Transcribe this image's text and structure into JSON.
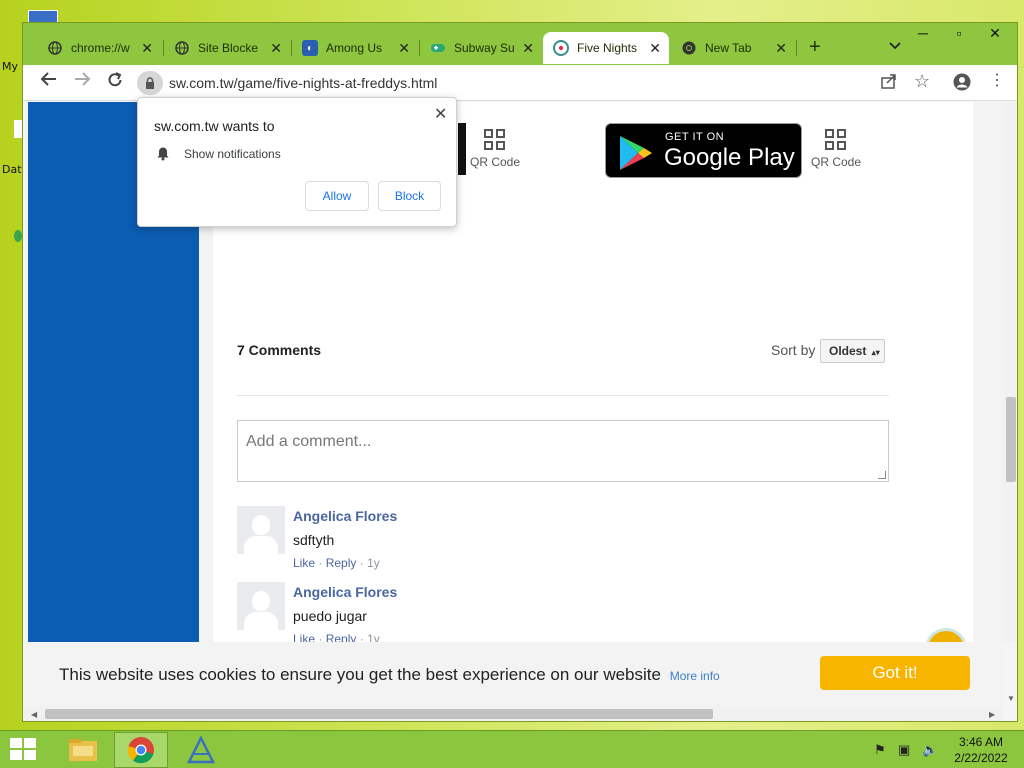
{
  "desktop": {
    "icons": [
      {
        "label": "My"
      },
      {
        "label": "Dat"
      }
    ]
  },
  "browser": {
    "tabs": [
      {
        "label": "chrome://w",
        "icon": "globe-icon",
        "active": false
      },
      {
        "label": "Site Blocke",
        "icon": "globe-icon",
        "active": false
      },
      {
        "label": "Among Us",
        "icon": "app-icon",
        "active": false
      },
      {
        "label": "Subway Su",
        "icon": "gamepad-icon",
        "active": false
      },
      {
        "label": "Five Nights",
        "icon": "site-icon",
        "active": true
      },
      {
        "label": "New Tab",
        "icon": "chrome-icon",
        "active": false
      }
    ],
    "new_tab_symbol": "+",
    "url": "sw.com.tw/game/five-nights-at-freddys.html"
  },
  "page": {
    "store": {
      "small_text": "GET IT ON",
      "big_text": "Google Play"
    },
    "qr_label_1": "QR Code",
    "qr_label_2": "QR Code",
    "comments": {
      "count_label": "7 Comments",
      "sort_label": "Sort by",
      "sort_value": "Oldest",
      "input_placeholder": "Add a comment...",
      "items": [
        {
          "author": "Angelica Flores",
          "text": "sdftyth",
          "like": "Like",
          "reply": "Reply",
          "age": "1y"
        },
        {
          "author": "Angelica Flores",
          "text": "puedo jugar",
          "like": "Like",
          "reply": "Reply",
          "age": "1y"
        }
      ]
    },
    "cookie": {
      "text": "This website uses cookies to ensure you get the best experience on our website",
      "more": "More info",
      "button": "Got it!"
    }
  },
  "permission_popup": {
    "title": "sw.com.tw wants to",
    "permission": "Show notifications",
    "allow": "Allow",
    "block": "Block"
  },
  "taskbar": {
    "time": "3:46 AM",
    "date": "2/22/2022"
  },
  "colors": {
    "accent_green": "#8ec63f",
    "left_panel_blue": "#0b5cb3",
    "cookie_button": "#f8b500",
    "comment_author": "#4b66a0"
  }
}
